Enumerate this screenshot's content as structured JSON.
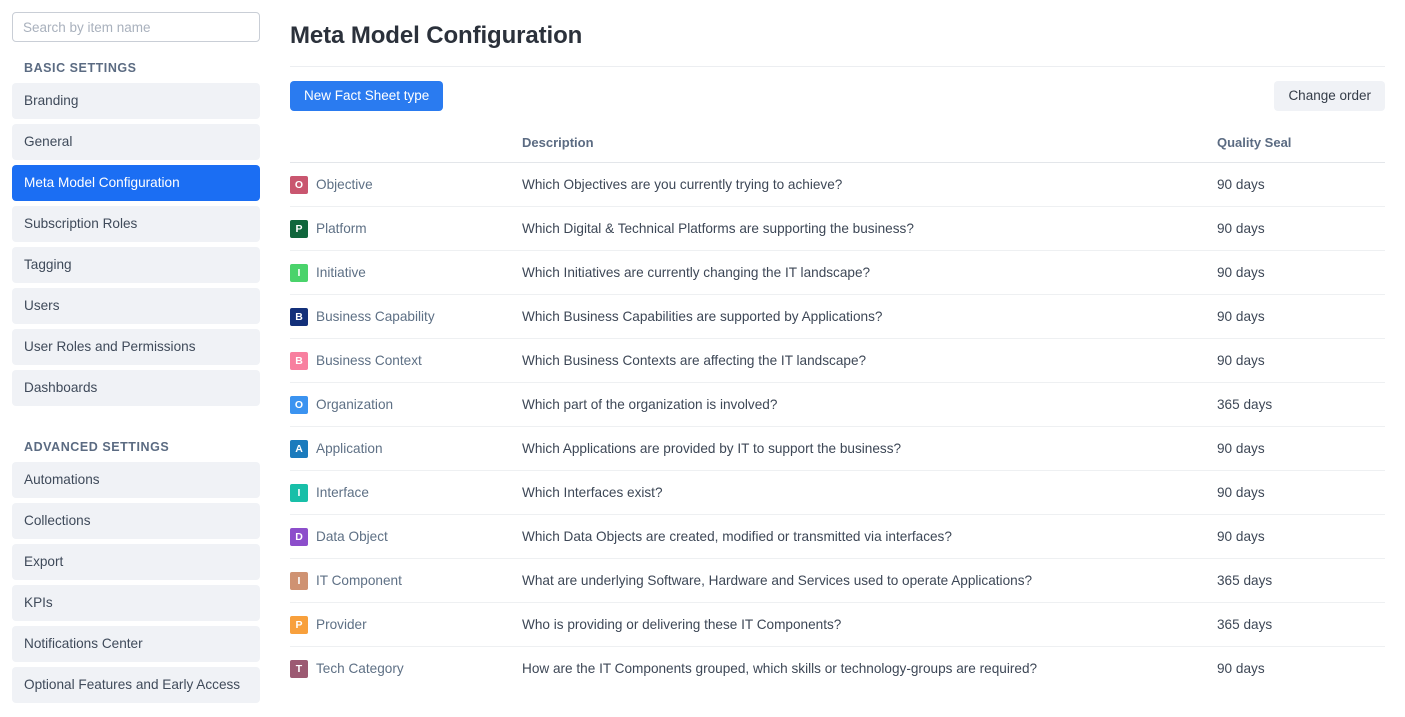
{
  "sidebar": {
    "search": {
      "placeholder": "Search by item name",
      "value": ""
    },
    "sections": [
      {
        "title": "BASIC SETTINGS",
        "items": [
          {
            "label": "Branding",
            "active": false
          },
          {
            "label": "General",
            "active": false
          },
          {
            "label": "Meta Model Configuration",
            "active": true
          },
          {
            "label": "Subscription Roles",
            "active": false
          },
          {
            "label": "Tagging",
            "active": false
          },
          {
            "label": "Users",
            "active": false
          },
          {
            "label": "User Roles and Permissions",
            "active": false
          },
          {
            "label": "Dashboards",
            "active": false
          }
        ]
      },
      {
        "title": "ADVANCED SETTINGS",
        "items": [
          {
            "label": "Automations",
            "active": false
          },
          {
            "label": "Collections",
            "active": false
          },
          {
            "label": "Export",
            "active": false
          },
          {
            "label": "KPIs",
            "active": false
          },
          {
            "label": "Notifications Center",
            "active": false
          },
          {
            "label": "Optional Features and Early Access",
            "active": false
          }
        ]
      }
    ]
  },
  "main": {
    "page_title": "Meta Model Configuration",
    "new_fact_sheet_label": "New Fact Sheet type",
    "change_order_label": "Change order",
    "table": {
      "headers": {
        "name": "",
        "description": "Description",
        "quality_seal": "Quality Seal"
      },
      "rows": [
        {
          "initial": "O",
          "color": "#c9566f",
          "name": "Objective",
          "description": "Which Objectives are you currently trying to achieve?",
          "quality_seal": "90 days"
        },
        {
          "initial": "P",
          "color": "#10663c",
          "name": "Platform",
          "description": "Which Digital & Technical Platforms are supporting the business?",
          "quality_seal": "90 days"
        },
        {
          "initial": "I",
          "color": "#4ad36b",
          "name": "Initiative",
          "description": "Which Initiatives are currently changing the IT landscape?",
          "quality_seal": "90 days"
        },
        {
          "initial": "B",
          "color": "#13307a",
          "name": "Business Capability",
          "description": "Which Business Capabilities are supported by Applications?",
          "quality_seal": "90 days"
        },
        {
          "initial": "B",
          "color": "#f87f9f",
          "name": "Business Context",
          "description": "Which Business Contexts are affecting the IT landscape?",
          "quality_seal": "90 days"
        },
        {
          "initial": "O",
          "color": "#3b93f0",
          "name": "Organization",
          "description": "Which part of the organization is involved?",
          "quality_seal": "365 days"
        },
        {
          "initial": "A",
          "color": "#1b7bbd",
          "name": "Application",
          "description": "Which Applications are provided by IT to support the business?",
          "quality_seal": "90 days"
        },
        {
          "initial": "I",
          "color": "#18bfa8",
          "name": "Interface",
          "description": "Which Interfaces exist?",
          "quality_seal": "90 days"
        },
        {
          "initial": "D",
          "color": "#8c4ecb",
          "name": "Data Object",
          "description": "Which Data Objects are created, modified or transmitted via interfaces?",
          "quality_seal": "90 days"
        },
        {
          "initial": "I",
          "color": "#cf9272",
          "name": "IT Component",
          "description": "What are underlying Software, Hardware and Services used to operate Applications?",
          "quality_seal": "365 days"
        },
        {
          "initial": "P",
          "color": "#f8a03c",
          "name": "Provider",
          "description": "Who is providing or delivering these IT Components?",
          "quality_seal": "365 days"
        },
        {
          "initial": "T",
          "color": "#9c5a72",
          "name": "Tech Category",
          "description": "How are the IT Components grouped, which skills or technology-groups are required?",
          "quality_seal": "90 days"
        }
      ]
    }
  },
  "colors": {
    "accent": "#1b6ef3",
    "primary_button": "#2a7bf0",
    "sidebar_item_bg": "#f0f2f6",
    "header_text": "#5b6b82"
  }
}
